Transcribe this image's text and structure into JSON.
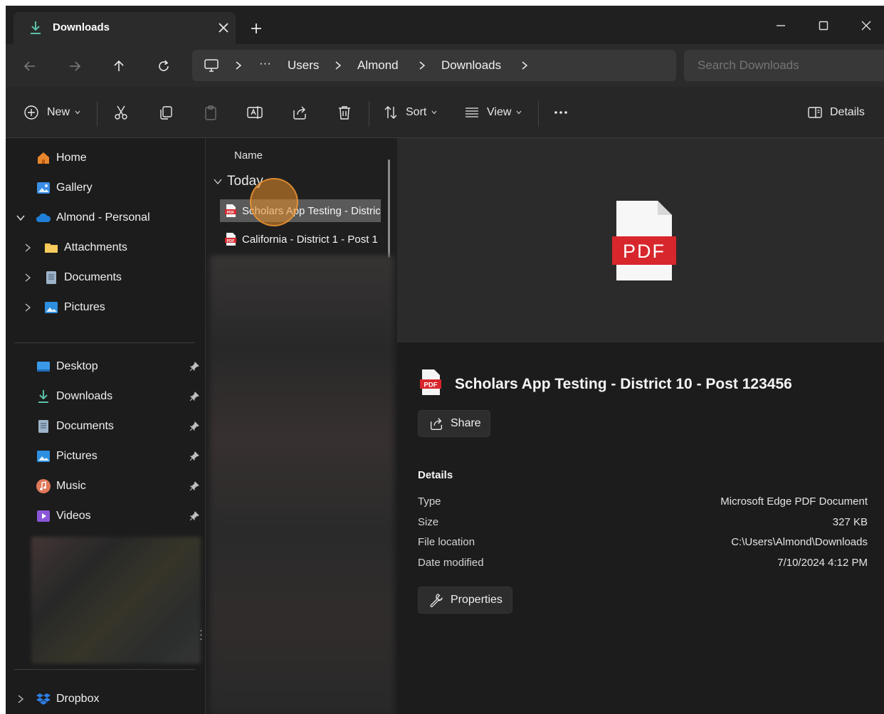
{
  "tab": {
    "title": "Downloads"
  },
  "address": {
    "ellipsis": "···",
    "crumbs": [
      "Users",
      "Almond",
      "Downloads"
    ]
  },
  "search": {
    "placeholder": "Search Downloads"
  },
  "toolbar": {
    "new_label": "New",
    "sort_label": "Sort",
    "view_label": "View",
    "details_label": "Details"
  },
  "sidebar": {
    "top": [
      {
        "label": "Home"
      },
      {
        "label": "Gallery"
      },
      {
        "label": "Almond - Personal"
      }
    ],
    "onedrive_children": [
      {
        "label": "Attachments"
      },
      {
        "label": "Documents"
      },
      {
        "label": "Pictures"
      }
    ],
    "quick_access": [
      {
        "label": "Desktop"
      },
      {
        "label": "Downloads"
      },
      {
        "label": "Documents"
      },
      {
        "label": "Pictures"
      },
      {
        "label": "Music"
      },
      {
        "label": "Videos"
      }
    ],
    "bottom": [
      {
        "label": "Dropbox"
      }
    ]
  },
  "filelist": {
    "column_name": "Name",
    "group_label": "Today",
    "files": [
      {
        "name": "Scholars App Testing - District 10 - Post 123456",
        "selected": true
      },
      {
        "name": "California - District 1 - Post 1",
        "selected": false
      }
    ]
  },
  "details": {
    "preview_label": "PDF",
    "file_icon_label": "PDF",
    "title": "Scholars App Testing - District 10 - Post 123456",
    "share_label": "Share",
    "section_title": "Details",
    "rows": [
      {
        "key": "Type",
        "value": "Microsoft Edge PDF Document"
      },
      {
        "key": "Size",
        "value": "327 KB"
      },
      {
        "key": "File location",
        "value": "C:\\Users\\Almond\\Downloads"
      },
      {
        "key": "Date modified",
        "value": "7/10/2024 4:12 PM"
      }
    ],
    "properties_label": "Properties"
  },
  "colors": {
    "accent_pdf": "#d7262c",
    "selection": "#5a5a5a",
    "cursor_highlight": "#e88c28"
  }
}
